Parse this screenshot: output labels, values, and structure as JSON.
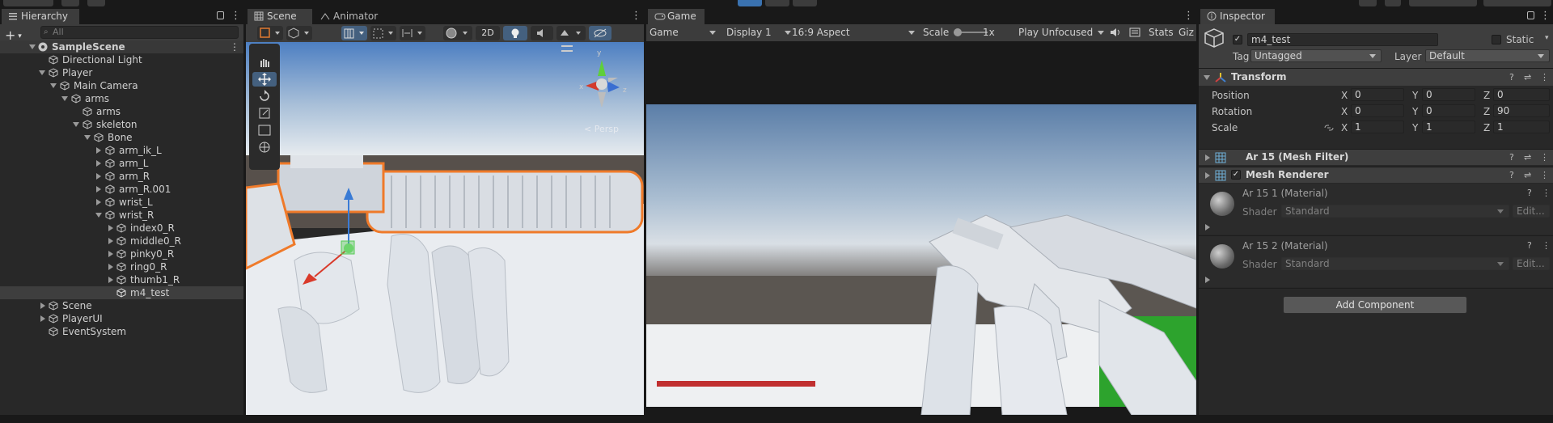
{
  "hierarchy": {
    "tab_label": "Hierarchy",
    "search_placeholder": "All",
    "add_label": "+",
    "items": [
      {
        "label": "SampleScene"
      },
      {
        "label": "Directional Light"
      },
      {
        "label": "Player"
      },
      {
        "label": "Main Camera"
      },
      {
        "label": "arms"
      },
      {
        "label": "arms"
      },
      {
        "label": "skeleton"
      },
      {
        "label": "Bone"
      },
      {
        "label": "arm_ik_L"
      },
      {
        "label": "arm_L"
      },
      {
        "label": "arm_R"
      },
      {
        "label": "arm_R.001"
      },
      {
        "label": "wrist_L"
      },
      {
        "label": "wrist_R"
      },
      {
        "label": "index0_R"
      },
      {
        "label": "middle0_R"
      },
      {
        "label": "pinky0_R"
      },
      {
        "label": "ring0_R"
      },
      {
        "label": "thumb1_R"
      },
      {
        "label": "m4_test"
      },
      {
        "label": "Scene"
      },
      {
        "label": "PlayerUI"
      },
      {
        "label": "EventSystem"
      }
    ]
  },
  "scene": {
    "tabs": [
      {
        "label": "Scene"
      },
      {
        "label": "Animator"
      }
    ],
    "toolbar": {
      "mode_2d": "2D"
    },
    "persp_label": "< Persp",
    "gizmo_axes": {
      "x": "x",
      "y": "y",
      "z": "z"
    }
  },
  "game": {
    "tab_label": "Game",
    "toolbar": {
      "view": "Game",
      "display": "Display 1",
      "aspect": "16:9 Aspect",
      "scale_label": "Scale",
      "scale_value": "1x",
      "play_mode": "Play Unfocused",
      "stats": "Stats",
      "gizmos": "Giz"
    },
    "health_bar_color": "#c03030"
  },
  "inspector": {
    "tab_label": "Inspector",
    "object_name": "m4_test",
    "static_label": "Static",
    "tag_label": "Tag",
    "tag_value": "Untagged",
    "layer_label": "Layer",
    "layer_value": "Default",
    "transform": {
      "title": "Transform",
      "position": {
        "label": "Position",
        "x": "0",
        "y": "0",
        "z": "0"
      },
      "rotation": {
        "label": "Rotation",
        "x": "0",
        "y": "0",
        "z": "90"
      },
      "scale": {
        "label": "Scale",
        "x": "1",
        "y": "1",
        "z": "1"
      },
      "axis_x": "X",
      "axis_y": "Y",
      "axis_z": "Z"
    },
    "mesh_filter_title": "Ar 15 (Mesh Filter)",
    "mesh_renderer_title": "Mesh Renderer",
    "materials": [
      {
        "name": "Ar 15 1 (Material)",
        "shader_label": "Shader",
        "shader": "Standard",
        "edit": "Edit..."
      },
      {
        "name": "Ar 15 2 (Material)",
        "shader_label": "Shader",
        "shader": "Standard",
        "edit": "Edit..."
      }
    ],
    "add_component": "Add Component"
  }
}
